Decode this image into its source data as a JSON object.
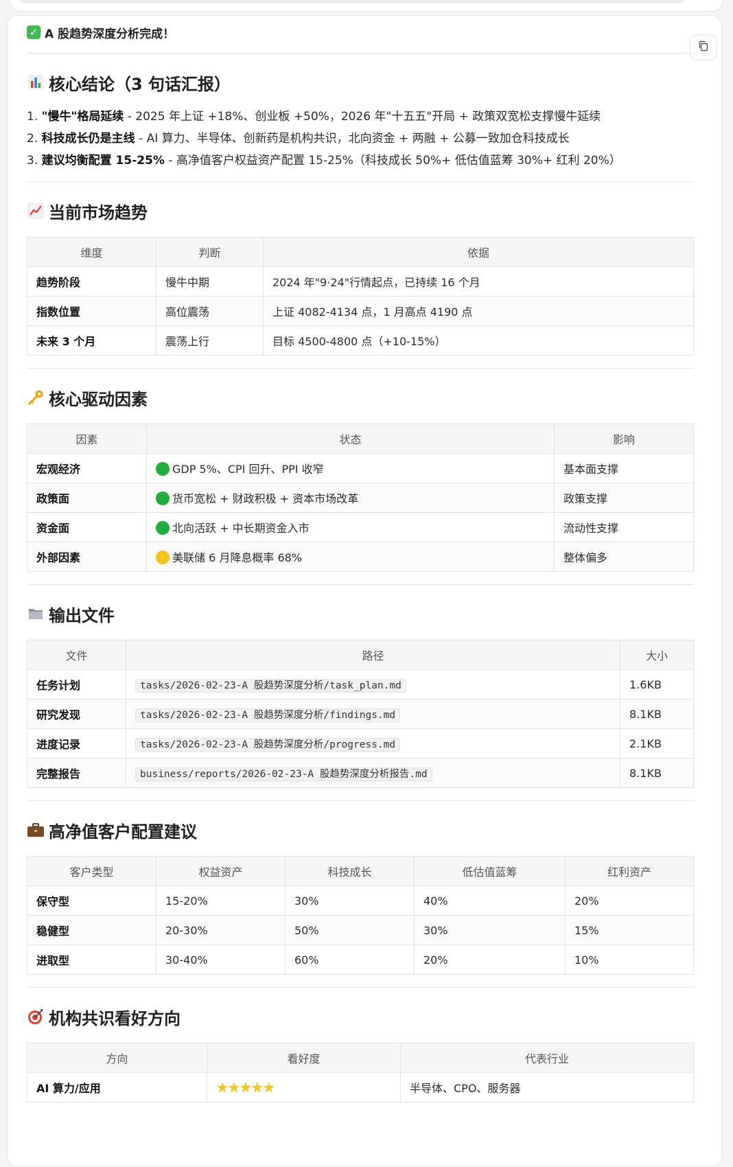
{
  "header": {
    "status_text": "A 股趋势深度分析完成！",
    "copy_icon": "copy-icon"
  },
  "summary": {
    "title": "核心结论（3 句话汇报）",
    "items": [
      {
        "num": "1.",
        "bold": "\"慢牛\"格局延续",
        "text": " - 2025 年上证 +18%、创业板 +50%，2026 年\"十五五\"开局 + 政策双宽松支撑慢牛延续"
      },
      {
        "num": "2.",
        "bold": "科技成长仍是主线",
        "text": " - AI 算力、半导体、创新药是机构共识，北向资金 + 两融 + 公募一致加仓科技成长"
      },
      {
        "num": "3.",
        "bold": "建议均衡配置 15-25%",
        "text": " - 高净值客户权益资产配置 15-25%（科技成长 50%+ 低估值蓝筹 30%+ 红利 20%）"
      }
    ]
  },
  "trend": {
    "title": "当前市场趋势",
    "headers": [
      "维度",
      "判断",
      "依据"
    ],
    "rows": [
      [
        "趋势阶段",
        "慢牛中期",
        "2024 年\"9·24\"行情起点，已持续 16 个月"
      ],
      [
        "指数位置",
        "高位震荡",
        "上证 4082-4134 点，1 月高点 4190 点"
      ],
      [
        "未来 3 个月",
        "震荡上行",
        "目标 4500-4800 点（+10-15%）"
      ]
    ]
  },
  "drivers": {
    "title": "核心驱动因素",
    "headers": [
      "因素",
      "状态",
      "影响"
    ],
    "rows": [
      {
        "factor": "宏观经济",
        "status_color": "#1fad3b",
        "status": "GDP 5%、CPI 回升、PPI 收窄",
        "impact": "基本面支撑"
      },
      {
        "factor": "政策面",
        "status_color": "#1fad3b",
        "status": "货币宽松 + 财政积极 + 资本市场改革",
        "impact": "政策支撑"
      },
      {
        "factor": "资金面",
        "status_color": "#1fad3b",
        "status": "北向活跃 + 中长期资金入市",
        "impact": "流动性支撑"
      },
      {
        "factor": "外部因素",
        "status_color": "#f5c518",
        "status": "美联储 6 月降息概率 68%",
        "impact": "整体偏多"
      }
    ]
  },
  "files": {
    "title": "输出文件",
    "headers": [
      "文件",
      "路径",
      "大小"
    ],
    "rows": [
      [
        "任务计划",
        "tasks/2026-02-23-A 股趋势深度分析/task_plan.md",
        "1.6KB"
      ],
      [
        "研究发现",
        "tasks/2026-02-23-A 股趋势深度分析/findings.md",
        "8.1KB"
      ],
      [
        "进度记录",
        "tasks/2026-02-23-A 股趋势深度分析/progress.md",
        "2.1KB"
      ],
      [
        "完整报告",
        "business/reports/2026-02-23-A 股趋势深度分析报告.md",
        "8.1KB"
      ]
    ]
  },
  "allocation": {
    "title": "高净值客户配置建议",
    "headers": [
      "客户类型",
      "权益资产",
      "科技成长",
      "低估值蓝筹",
      "红利资产"
    ],
    "rows": [
      [
        "保守型",
        "15-20%",
        "30%",
        "40%",
        "20%"
      ],
      [
        "稳健型",
        "20-30%",
        "50%",
        "30%",
        "15%"
      ],
      [
        "进取型",
        "30-40%",
        "60%",
        "20%",
        "10%"
      ]
    ]
  },
  "consensus": {
    "title": "机构共识看好方向",
    "headers": [
      "方向",
      "看好度",
      "代表行业"
    ],
    "rows": [
      {
        "direction": "AI 算力/应用",
        "stars": "★★★★★",
        "rating": 5,
        "industry": "半导体、CPO、服务器"
      }
    ]
  },
  "colors": {
    "check_green": "#3fb950",
    "dot_green": "#1fad3b",
    "dot_yellow": "#f5c518"
  }
}
